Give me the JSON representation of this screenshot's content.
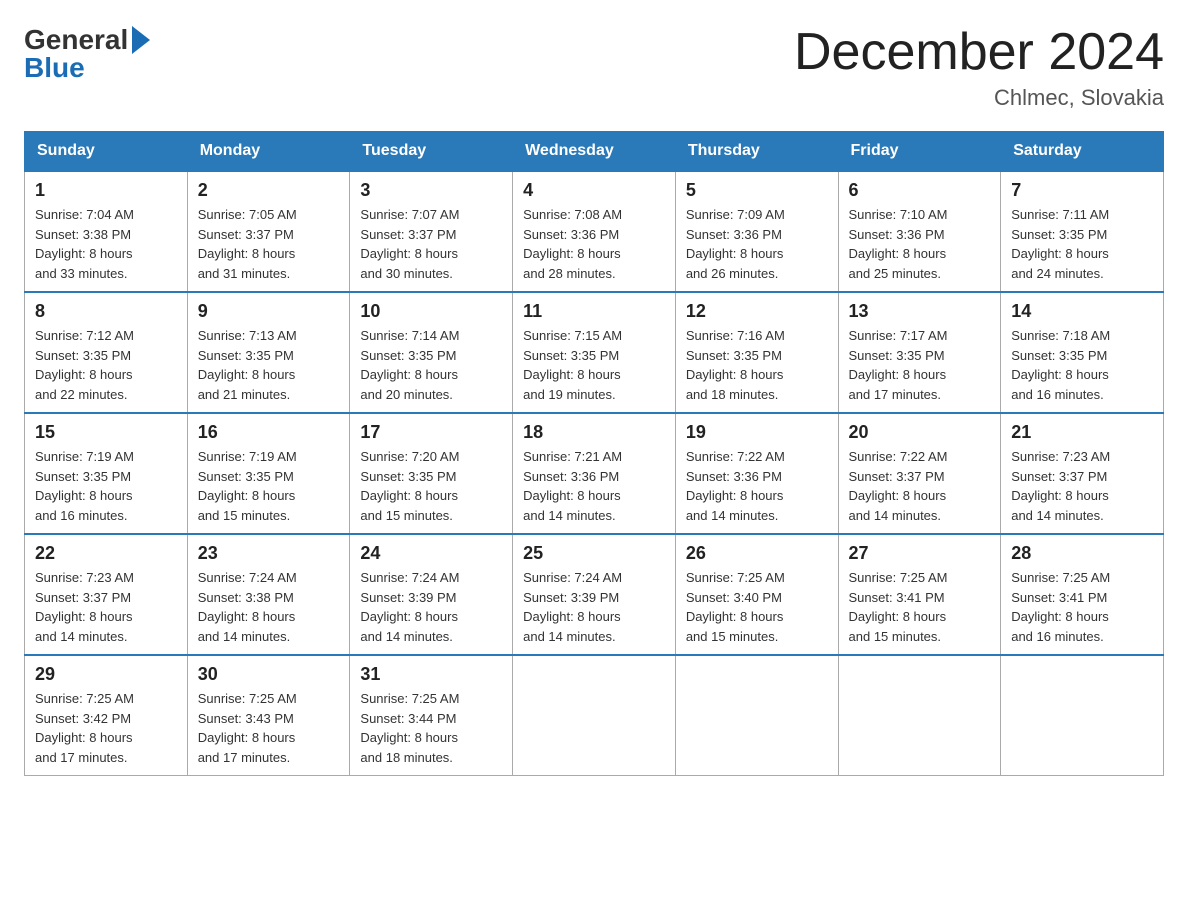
{
  "header": {
    "logo_general": "General",
    "logo_blue": "Blue",
    "month_title": "December 2024",
    "location": "Chlmec, Slovakia"
  },
  "days_of_week": [
    "Sunday",
    "Monday",
    "Tuesday",
    "Wednesday",
    "Thursday",
    "Friday",
    "Saturday"
  ],
  "weeks": [
    [
      {
        "day": "1",
        "sunrise": "7:04 AM",
        "sunset": "3:38 PM",
        "daylight": "8 hours and 33 minutes."
      },
      {
        "day": "2",
        "sunrise": "7:05 AM",
        "sunset": "3:37 PM",
        "daylight": "8 hours and 31 minutes."
      },
      {
        "day": "3",
        "sunrise": "7:07 AM",
        "sunset": "3:37 PM",
        "daylight": "8 hours and 30 minutes."
      },
      {
        "day": "4",
        "sunrise": "7:08 AM",
        "sunset": "3:36 PM",
        "daylight": "8 hours and 28 minutes."
      },
      {
        "day": "5",
        "sunrise": "7:09 AM",
        "sunset": "3:36 PM",
        "daylight": "8 hours and 26 minutes."
      },
      {
        "day": "6",
        "sunrise": "7:10 AM",
        "sunset": "3:36 PM",
        "daylight": "8 hours and 25 minutes."
      },
      {
        "day": "7",
        "sunrise": "7:11 AM",
        "sunset": "3:35 PM",
        "daylight": "8 hours and 24 minutes."
      }
    ],
    [
      {
        "day": "8",
        "sunrise": "7:12 AM",
        "sunset": "3:35 PM",
        "daylight": "8 hours and 22 minutes."
      },
      {
        "day": "9",
        "sunrise": "7:13 AM",
        "sunset": "3:35 PM",
        "daylight": "8 hours and 21 minutes."
      },
      {
        "day": "10",
        "sunrise": "7:14 AM",
        "sunset": "3:35 PM",
        "daylight": "8 hours and 20 minutes."
      },
      {
        "day": "11",
        "sunrise": "7:15 AM",
        "sunset": "3:35 PM",
        "daylight": "8 hours and 19 minutes."
      },
      {
        "day": "12",
        "sunrise": "7:16 AM",
        "sunset": "3:35 PM",
        "daylight": "8 hours and 18 minutes."
      },
      {
        "day": "13",
        "sunrise": "7:17 AM",
        "sunset": "3:35 PM",
        "daylight": "8 hours and 17 minutes."
      },
      {
        "day": "14",
        "sunrise": "7:18 AM",
        "sunset": "3:35 PM",
        "daylight": "8 hours and 16 minutes."
      }
    ],
    [
      {
        "day": "15",
        "sunrise": "7:19 AM",
        "sunset": "3:35 PM",
        "daylight": "8 hours and 16 minutes."
      },
      {
        "day": "16",
        "sunrise": "7:19 AM",
        "sunset": "3:35 PM",
        "daylight": "8 hours and 15 minutes."
      },
      {
        "day": "17",
        "sunrise": "7:20 AM",
        "sunset": "3:35 PM",
        "daylight": "8 hours and 15 minutes."
      },
      {
        "day": "18",
        "sunrise": "7:21 AM",
        "sunset": "3:36 PM",
        "daylight": "8 hours and 14 minutes."
      },
      {
        "day": "19",
        "sunrise": "7:22 AM",
        "sunset": "3:36 PM",
        "daylight": "8 hours and 14 minutes."
      },
      {
        "day": "20",
        "sunrise": "7:22 AM",
        "sunset": "3:37 PM",
        "daylight": "8 hours and 14 minutes."
      },
      {
        "day": "21",
        "sunrise": "7:23 AM",
        "sunset": "3:37 PM",
        "daylight": "8 hours and 14 minutes."
      }
    ],
    [
      {
        "day": "22",
        "sunrise": "7:23 AM",
        "sunset": "3:37 PM",
        "daylight": "8 hours and 14 minutes."
      },
      {
        "day": "23",
        "sunrise": "7:24 AM",
        "sunset": "3:38 PM",
        "daylight": "8 hours and 14 minutes."
      },
      {
        "day": "24",
        "sunrise": "7:24 AM",
        "sunset": "3:39 PM",
        "daylight": "8 hours and 14 minutes."
      },
      {
        "day": "25",
        "sunrise": "7:24 AM",
        "sunset": "3:39 PM",
        "daylight": "8 hours and 14 minutes."
      },
      {
        "day": "26",
        "sunrise": "7:25 AM",
        "sunset": "3:40 PM",
        "daylight": "8 hours and 15 minutes."
      },
      {
        "day": "27",
        "sunrise": "7:25 AM",
        "sunset": "3:41 PM",
        "daylight": "8 hours and 15 minutes."
      },
      {
        "day": "28",
        "sunrise": "7:25 AM",
        "sunset": "3:41 PM",
        "daylight": "8 hours and 16 minutes."
      }
    ],
    [
      {
        "day": "29",
        "sunrise": "7:25 AM",
        "sunset": "3:42 PM",
        "daylight": "8 hours and 17 minutes."
      },
      {
        "day": "30",
        "sunrise": "7:25 AM",
        "sunset": "3:43 PM",
        "daylight": "8 hours and 17 minutes."
      },
      {
        "day": "31",
        "sunrise": "7:25 AM",
        "sunset": "3:44 PM",
        "daylight": "8 hours and 18 minutes."
      },
      null,
      null,
      null,
      null
    ]
  ],
  "labels": {
    "sunrise": "Sunrise:",
    "sunset": "Sunset:",
    "daylight": "Daylight:"
  }
}
